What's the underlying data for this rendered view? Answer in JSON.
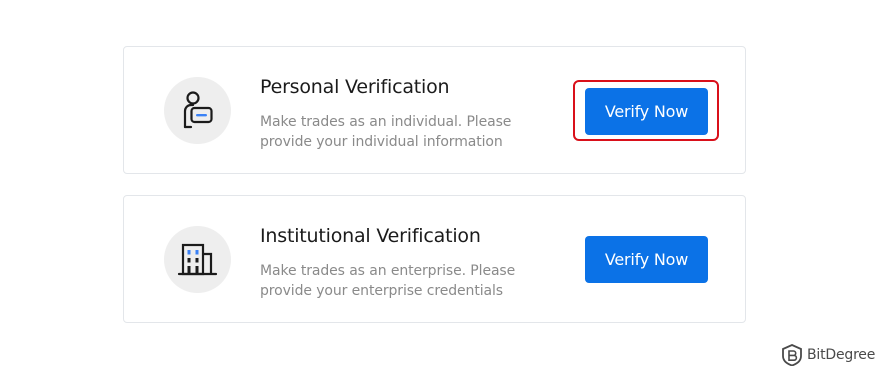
{
  "cards": [
    {
      "title": "Personal Verification",
      "description": "Make trades as an individual. Please provide your individual information",
      "button_label": "Verify Now",
      "icon": "person-id-icon",
      "highlighted": true
    },
    {
      "title": "Institutional Verification",
      "description": "Make trades as an enterprise. Please provide your enterprise credentials",
      "button_label": "Verify Now",
      "icon": "building-icon",
      "highlighted": false
    }
  ],
  "watermark": {
    "text": "BitDegree",
    "icon": "bitdegree-logo-icon"
  },
  "colors": {
    "button": "#0b72e7",
    "highlight": "#d9101a",
    "icon_accent": "#3b82f6",
    "icon_bg": "#eeeeee"
  }
}
